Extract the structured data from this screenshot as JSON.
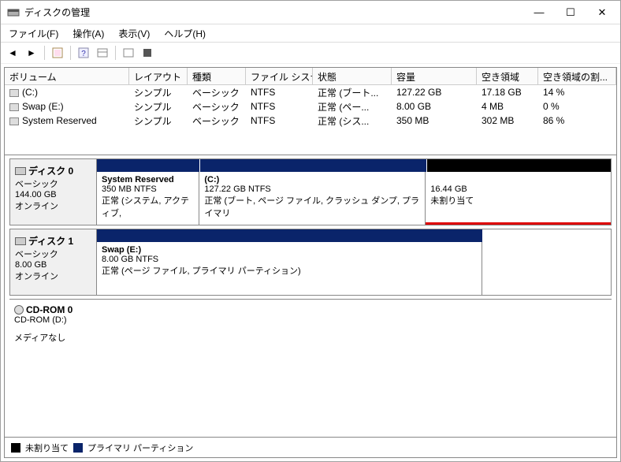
{
  "window": {
    "title": "ディスクの管理"
  },
  "menu": {
    "file": "ファイル(F)",
    "action": "操作(A)",
    "view": "表示(V)",
    "help": "ヘルプ(H)"
  },
  "grid": {
    "headers": [
      "ボリューム",
      "レイアウト",
      "種類",
      "ファイル システム",
      "状態",
      "容量",
      "空き領域",
      "空き領域の割..."
    ],
    "rows": [
      {
        "name": "(C:)",
        "layout": "シンプル",
        "kind": "ベーシック",
        "fs": "NTFS",
        "status": "正常 (ブート...",
        "cap": "127.22 GB",
        "free": "17.18 GB",
        "pct": "14 %"
      },
      {
        "name": "Swap (E:)",
        "layout": "シンプル",
        "kind": "ベーシック",
        "fs": "NTFS",
        "status": "正常 (ペー...",
        "cap": "8.00 GB",
        "free": "4 MB",
        "pct": "0 %"
      },
      {
        "name": "System Reserved",
        "layout": "シンプル",
        "kind": "ベーシック",
        "fs": "NTFS",
        "status": "正常 (シス...",
        "cap": "350 MB",
        "free": "302 MB",
        "pct": "86 %"
      }
    ]
  },
  "disks": {
    "d0": {
      "name": "ディスク 0",
      "kind": "ベーシック",
      "size": "144.00 GB",
      "status": "オンライン",
      "p0": {
        "name": "System Reserved",
        "size": "350 MB NTFS",
        "status": "正常 (システム, アクティブ,"
      },
      "p1": {
        "name": "(C:)",
        "size": "127.22 GB NTFS",
        "status": "正常 (ブート, ページ ファイル, クラッシュ ダンプ, プライマリ"
      },
      "p2": {
        "size": "16.44 GB",
        "status": "未割り当て"
      }
    },
    "d1": {
      "name": "ディスク 1",
      "kind": "ベーシック",
      "size": "8.00 GB",
      "status": "オンライン",
      "p0": {
        "name": "Swap  (E:)",
        "size": "8.00 GB NTFS",
        "status": "正常 (ページ ファイル, プライマリ パーティション)"
      }
    },
    "cd": {
      "name": "CD-ROM 0",
      "dev": "CD-ROM (D:)",
      "status": "メディアなし"
    }
  },
  "legend": {
    "unalloc": "未割り当て",
    "primary": "プライマリ パーティション"
  }
}
